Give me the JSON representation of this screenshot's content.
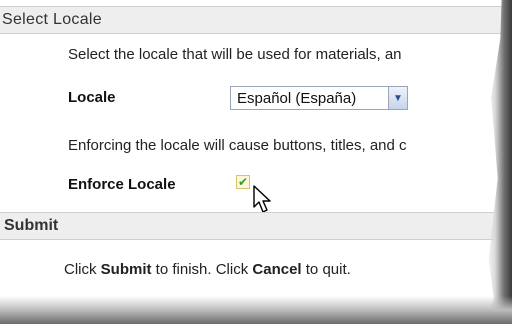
{
  "section_locale": {
    "title": "Select Locale"
  },
  "intro_text": "Select the locale that will be used for materials, an",
  "locale_field": {
    "label": "Locale",
    "selected": "Español (España)"
  },
  "enforce_text": "Enforcing the locale will cause buttons, titles, and c",
  "enforce_field": {
    "label": "Enforce Locale",
    "checked": true
  },
  "section_submit": {
    "title": "Submit"
  },
  "footer": {
    "part1": "Click ",
    "submit_word": "Submit",
    "part2": " to finish. Click ",
    "cancel_word": "Cancel",
    "part3": " to quit."
  },
  "icons": {
    "dropdown": "chevron-down-icon",
    "check": "checkmark-icon",
    "cursor": "mouse-pointer-icon"
  }
}
